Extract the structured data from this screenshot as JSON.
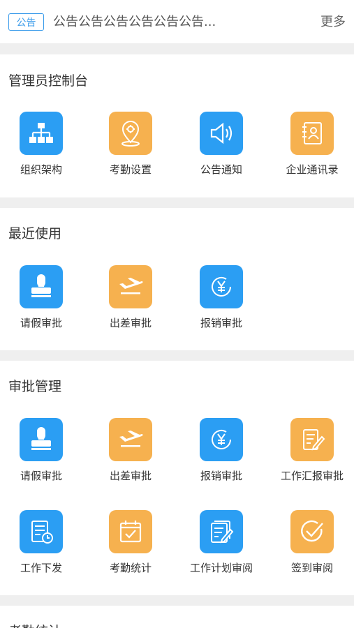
{
  "notice": {
    "badge": "公告",
    "text": "公告公告公告公告公告公告...",
    "more": "更多"
  },
  "sections": [
    {
      "title": "管理员控制台",
      "items": [
        {
          "label": "组织架构",
          "icon": "org-chart-icon",
          "color": "#2b9ef3"
        },
        {
          "label": "考勤设置",
          "icon": "location-settings-icon",
          "color": "#f6b14f"
        },
        {
          "label": "公告通知",
          "icon": "speaker-icon",
          "color": "#2b9ef3"
        },
        {
          "label": "企业通讯录",
          "icon": "contacts-book-icon",
          "color": "#f6b14f"
        }
      ]
    },
    {
      "title": "最近使用",
      "items": [
        {
          "label": "请假审批",
          "icon": "stamp-icon",
          "color": "#2b9ef3"
        },
        {
          "label": "出差审批",
          "icon": "airplane-icon",
          "color": "#f6b14f"
        },
        {
          "label": "报销审批",
          "icon": "yen-refund-icon",
          "color": "#2b9ef3"
        }
      ]
    },
    {
      "title": "审批管理",
      "items": [
        {
          "label": "请假审批",
          "icon": "stamp-icon",
          "color": "#2b9ef3"
        },
        {
          "label": "出差审批",
          "icon": "airplane-icon",
          "color": "#f6b14f"
        },
        {
          "label": "报销审批",
          "icon": "yen-refund-icon",
          "color": "#2b9ef3"
        },
        {
          "label": "工作汇报审批",
          "icon": "report-edit-icon",
          "color": "#f6b14f"
        },
        {
          "label": "工作下发",
          "icon": "document-clock-icon",
          "color": "#2b9ef3"
        },
        {
          "label": "考勤统计",
          "icon": "calendar-check-icon",
          "color": "#f6b14f"
        },
        {
          "label": "工作计划审阅",
          "icon": "notes-edit-icon",
          "color": "#2b9ef3"
        },
        {
          "label": "签到审阅",
          "icon": "check-circle-icon",
          "color": "#f6b14f"
        }
      ]
    },
    {
      "title": "考勤统计"
    }
  ]
}
